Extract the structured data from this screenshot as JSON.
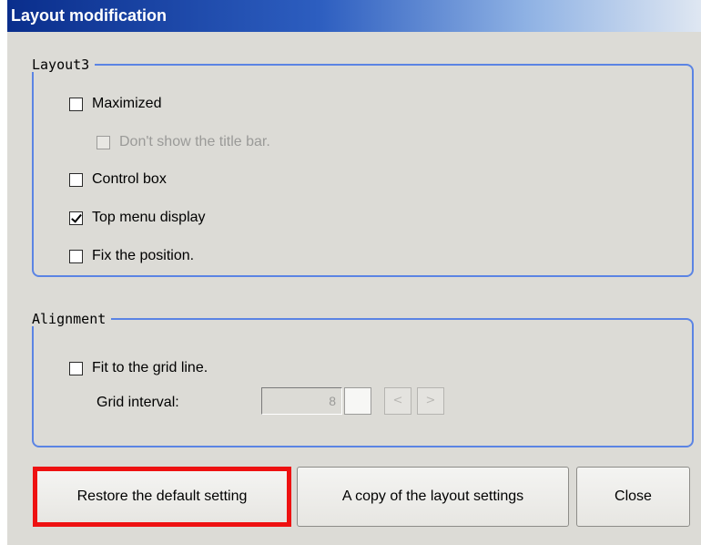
{
  "window": {
    "title": "Layout modification"
  },
  "layout_group": {
    "legend": "Layout3",
    "options": [
      {
        "label": "Maximized",
        "checked": false,
        "enabled": true
      },
      {
        "label": "Don't show the title bar.",
        "checked": false,
        "enabled": false
      },
      {
        "label": "Control box",
        "checked": false,
        "enabled": true
      },
      {
        "label": "Top menu display",
        "checked": true,
        "enabled": true
      },
      {
        "label": "Fix the position.",
        "checked": false,
        "enabled": true
      }
    ]
  },
  "alignment_group": {
    "legend": "Alignment",
    "fit_grid_label": "Fit to the grid line.",
    "fit_grid_checked": false,
    "grid_interval_label": "Grid interval:",
    "grid_interval_value": "8",
    "decrement_symbol": "<",
    "increment_symbol": ">"
  },
  "buttons": {
    "restore": "Restore the default setting",
    "copy": "A copy of the layout settings",
    "close": "Close"
  },
  "colors": {
    "title_bar": "#0a2e8c",
    "group_border": "#5b84e4",
    "highlight": "#ee1111",
    "dialog_bg": "#dcdbd6"
  }
}
